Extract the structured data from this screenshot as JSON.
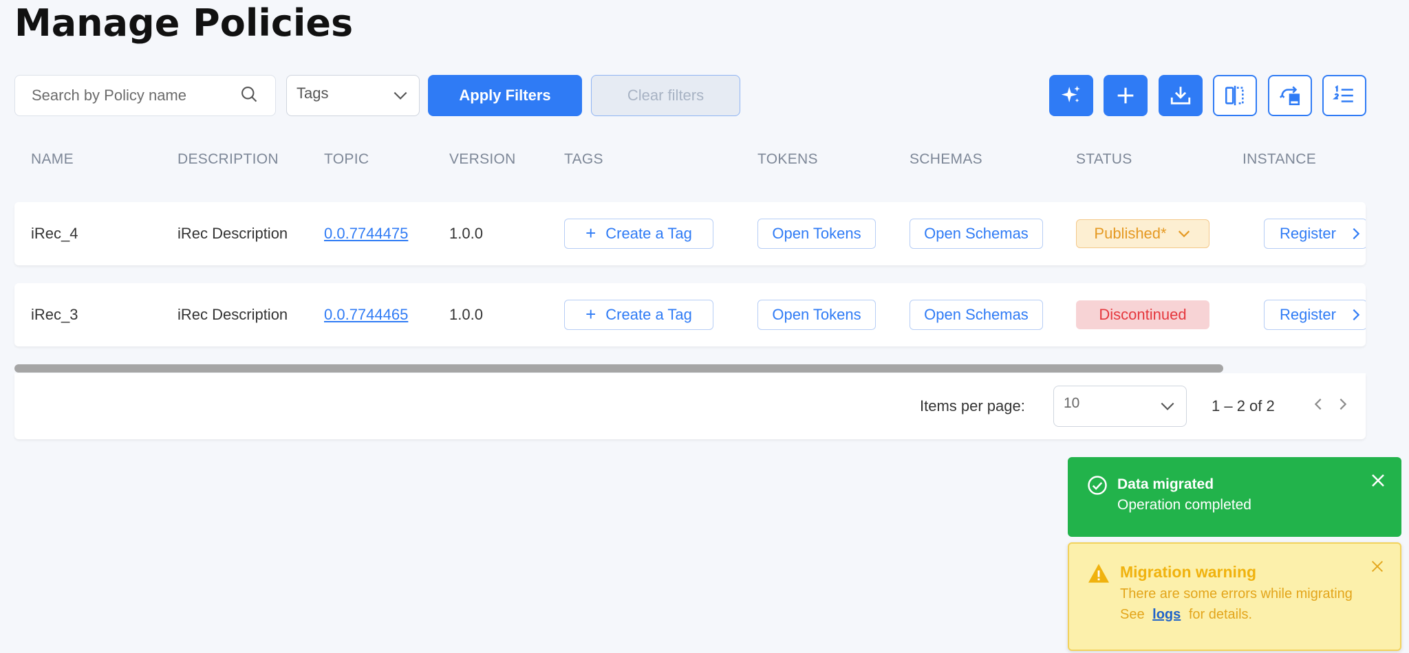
{
  "page": {
    "title": "Manage Policies"
  },
  "filters": {
    "search_placeholder": "Search by Policy name",
    "tags_placeholder": "Tags",
    "apply_label": "Apply Filters",
    "clear_label": "Clear filters"
  },
  "toolbar": {
    "icons": [
      "sparkle-icon",
      "plus-icon",
      "download-icon",
      "compare-icon",
      "migrate-icon",
      "list-ordered-icon"
    ]
  },
  "table": {
    "headers": [
      "NAME",
      "DESCRIPTION",
      "TOPIC",
      "VERSION",
      "TAGS",
      "TOKENS",
      "SCHEMAS",
      "STATUS",
      "INSTANCE"
    ],
    "rows": [
      {
        "name": "iRec_4",
        "description": "iRec Description",
        "topic": "0.0.7744475",
        "version": "1.0.0",
        "tag_action": "Create a Tag",
        "tokens": "Open Tokens",
        "schemas": "Open Schemas",
        "status": "Published*",
        "status_type": "published",
        "instance": "Register"
      },
      {
        "name": "iRec_3",
        "description": "iRec Description",
        "topic": "0.0.7744465",
        "version": "1.0.0",
        "tag_action": "Create a Tag",
        "tokens": "Open Tokens",
        "schemas": "Open Schemas",
        "status": "Discontinued",
        "status_type": "discontinued",
        "instance": "Register"
      }
    ]
  },
  "paginator": {
    "items_per_page_label": "Items per page:",
    "items_per_page_value": "10",
    "range": "1 – 2 of 2"
  },
  "toasts": {
    "success": {
      "title": "Data migrated",
      "message": "Operation completed"
    },
    "warning": {
      "title": "Migration warning",
      "message": "There are some errors while migrating",
      "details_prefix": "See",
      "details_link": "logs",
      "details_suffix": "for details."
    }
  },
  "colors": {
    "primary": "#2f7bf5",
    "success": "#22b34b",
    "warning_bg": "#fcf0ab",
    "published": "#e59922",
    "discontinued": "#e5373d"
  }
}
